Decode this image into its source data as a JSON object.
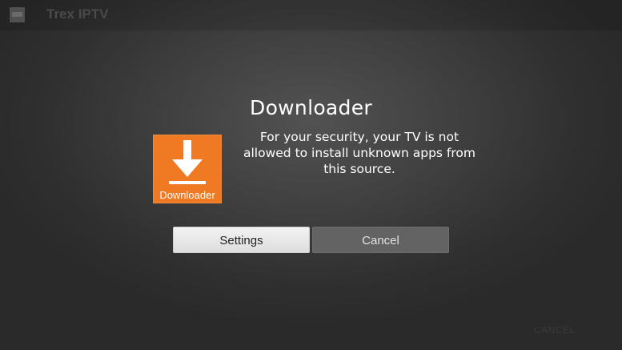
{
  "background_app": {
    "title": "Trex IPTV",
    "footer_cancel": "CANCEL"
  },
  "dialog": {
    "title": "Downloader",
    "icon": {
      "name": "download-arrow-icon",
      "label": "Downloader",
      "color": "#f07a24"
    },
    "message": "For your security, your TV is not allowed to install unknown apps from this source.",
    "buttons": {
      "settings_label": "Settings",
      "cancel_label": "Cancel"
    }
  }
}
